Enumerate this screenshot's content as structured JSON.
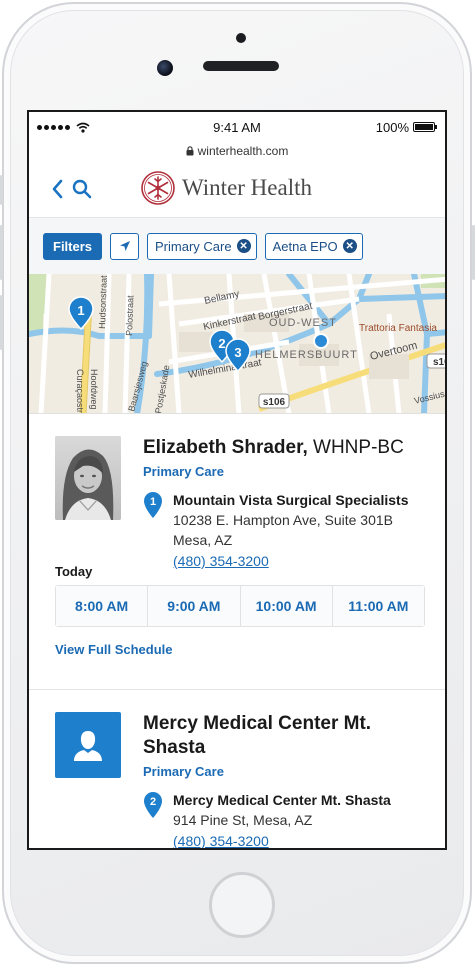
{
  "status_bar": {
    "time": "9:41 AM",
    "battery": "100%"
  },
  "browser": {
    "url": "winterhealth.com"
  },
  "header": {
    "logo_text": "Winter Health"
  },
  "filters": {
    "filters_label": "Filters",
    "chips": [
      {
        "label": "Primary Care"
      },
      {
        "label": "Aetna EPO"
      }
    ]
  },
  "map": {
    "labels": {
      "bellamy": "Bellamy",
      "kinkerstraat": "Kinkerstraat",
      "borgerstraat": "Borgerstraat",
      "oud_west": "OUD-WEST",
      "trattoria": "Trattoria Fantasia",
      "helmersbuurt": "HELMERSBUURT",
      "overtoom": "Overtoom",
      "wilhelminastraat": "Wilhelminastraat",
      "hoofdweg": "Hoofdweg",
      "curacaostraat": "Curaçaostraat",
      "baarsjesweg": "Baarsjesweg",
      "postjeskade": "Postjeskade",
      "polostraat": "Polostraat",
      "hudsonstraat": "Hudsonstraat",
      "vossius": "Vossius",
      "s106": "s106",
      "s10": "s10"
    },
    "pins": [
      {
        "number": "1"
      },
      {
        "number": "2"
      },
      {
        "number": "3"
      }
    ]
  },
  "providers": [
    {
      "name": "Elizabeth Shrader,",
      "credentials": "WHNP-BC",
      "specialty": "Primary Care",
      "pin": "1",
      "location_name": "Mountain Vista Surgical Specialists",
      "address_line1": "10238 E. Hampton Ave, Suite 301B",
      "address_line2": "Mesa, AZ",
      "phone": "(480) 354-3200",
      "day_label": "Today",
      "slots": [
        "8:00 AM",
        "9:00 AM",
        "10:00 AM",
        "11:00 AM"
      ],
      "schedule_link": "View Full Schedule"
    },
    {
      "name": "Mercy Medical Center Mt. Shasta",
      "specialty": "Primary Care",
      "pin": "2",
      "location_name": "Mercy Medical Center Mt. Shasta",
      "address_line1": "914 Pine St, Mesa, AZ",
      "phone": "(480) 354-3200"
    }
  ],
  "colors": {
    "brand_blue": "#1b6ab4",
    "logo_red": "#b0303c"
  }
}
